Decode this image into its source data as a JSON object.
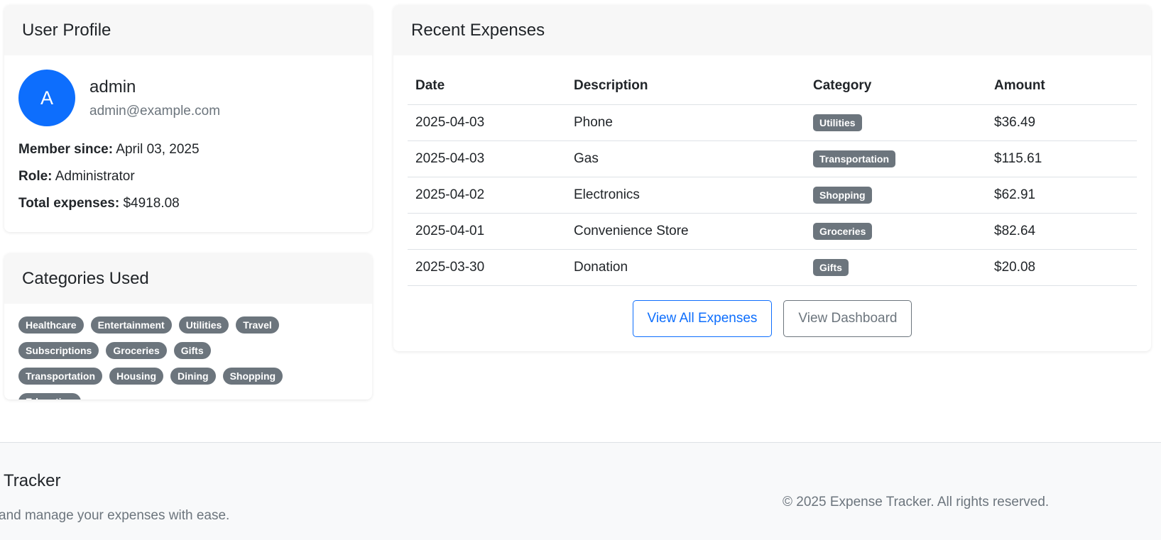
{
  "profile": {
    "header": "User Profile",
    "avatar_initial": "A",
    "username": "admin",
    "email": "admin@example.com",
    "member_since_label": "Member since:",
    "member_since_value": "April 03, 2025",
    "role_label": "Role:",
    "role_value": "Administrator",
    "total_label": "Total expenses:",
    "total_value": "$4918.08",
    "avatar_color": "#0d6efd"
  },
  "categories": {
    "header": "Categories Used",
    "items": [
      "Healthcare",
      "Entertainment",
      "Utilities",
      "Travel",
      "Subscriptions",
      "Groceries",
      "Gifts",
      "Transportation",
      "Housing",
      "Dining",
      "Shopping",
      "Education"
    ]
  },
  "expenses": {
    "header": "Recent Expenses",
    "columns": [
      "Date",
      "Description",
      "Category",
      "Amount"
    ],
    "rows": [
      {
        "date": "2025-04-03",
        "description": "Phone",
        "category": "Utilities",
        "amount": "$36.49"
      },
      {
        "date": "2025-04-03",
        "description": "Gas",
        "category": "Transportation",
        "amount": "$115.61"
      },
      {
        "date": "2025-04-02",
        "description": "Electronics",
        "category": "Shopping",
        "amount": "$62.91"
      },
      {
        "date": "2025-04-01",
        "description": "Convenience Store",
        "category": "Groceries",
        "amount": "$82.64"
      },
      {
        "date": "2025-03-30",
        "description": "Donation",
        "category": "Gifts",
        "amount": "$20.08"
      }
    ],
    "view_all_label": "View All Expenses",
    "view_dashboard_label": "View Dashboard"
  },
  "footer": {
    "title": "Tracker",
    "tagline": "and manage your expenses with ease.",
    "copyright": "© 2025 Expense Tracker. All rights reserved."
  }
}
